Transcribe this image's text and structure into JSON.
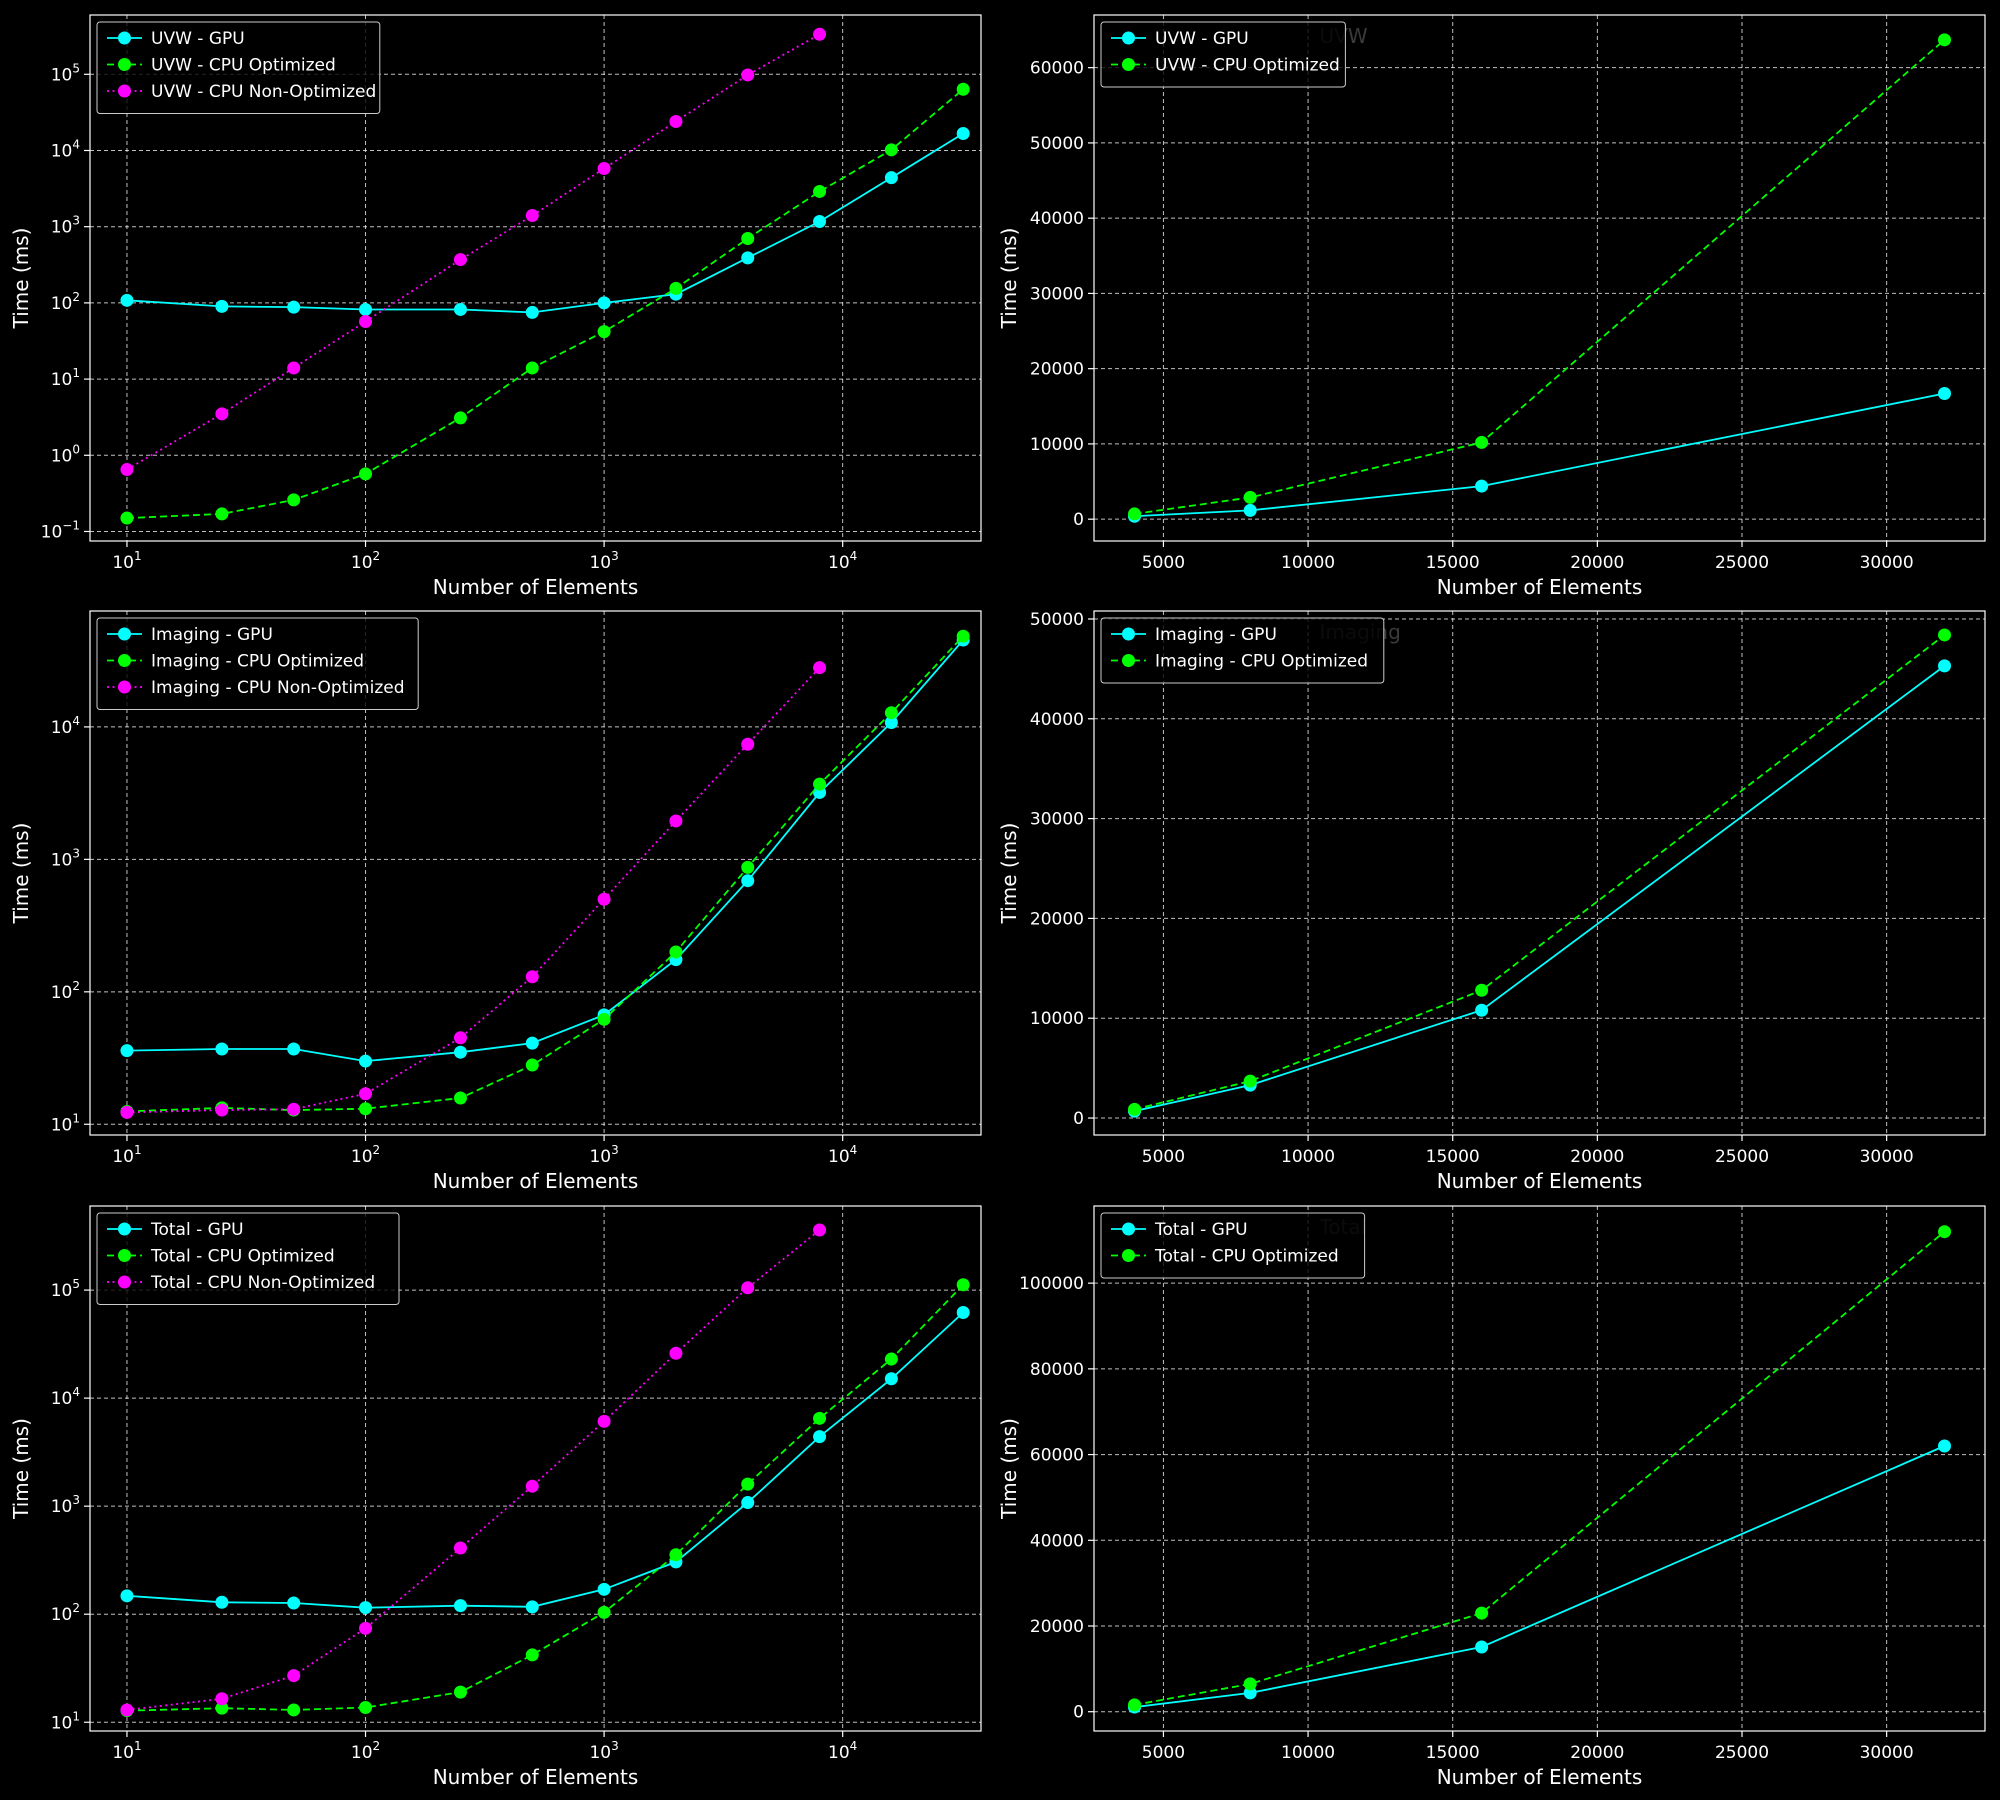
{
  "colors": {
    "background": "#000000",
    "foreground": "#ffffff",
    "grid": "#ffffff",
    "gpu": "#00ffff",
    "cpu_optimized": "#00ff00",
    "cpu_non_optimized": "#ff00ff",
    "faint_title": "#3a3a3a"
  },
  "chart_data": [
    {
      "type": "line",
      "panel": "top-left",
      "title": "",
      "xlabel": "Number of Elements",
      "ylabel": "Time (ms)",
      "xscale": "log",
      "yscale": "log",
      "xlim": [
        7,
        38000
      ],
      "ylim": [
        0.075,
        600000
      ],
      "grid": true,
      "legend_position": "upper-left",
      "x_ticks": [
        {
          "value": 10,
          "base": "10",
          "exp": "1"
        },
        {
          "value": 100,
          "base": "10",
          "exp": "2"
        },
        {
          "value": 1000,
          "base": "10",
          "exp": "3"
        },
        {
          "value": 10000,
          "base": "10",
          "exp": "4"
        }
      ],
      "y_ticks": [
        {
          "value": 0.1,
          "base": "10",
          "exp": "−1"
        },
        {
          "value": 1,
          "base": "10",
          "exp": "0"
        },
        {
          "value": 10,
          "base": "10",
          "exp": "1"
        },
        {
          "value": 100,
          "base": "10",
          "exp": "2"
        },
        {
          "value": 1000,
          "base": "10",
          "exp": "3"
        },
        {
          "value": 10000,
          "base": "10",
          "exp": "4"
        },
        {
          "value": 100000,
          "base": "10",
          "exp": "5"
        }
      ],
      "series": [
        {
          "name": "UVW - GPU",
          "color": "#00ffff",
          "style": "solid",
          "x": [
            10,
            25,
            50,
            100,
            250,
            500,
            1000,
            2000,
            4000,
            8000,
            16000,
            32000
          ],
          "y": [
            108,
            90,
            88,
            82,
            82,
            75,
            100,
            130,
            390,
            1170,
            4400,
            16700
          ]
        },
        {
          "name": "UVW - CPU Optimized",
          "color": "#00ff00",
          "style": "dashed",
          "x": [
            10,
            25,
            50,
            100,
            250,
            500,
            1000,
            2000,
            4000,
            8000,
            16000,
            32000
          ],
          "y": [
            0.15,
            0.17,
            0.26,
            0.57,
            3.1,
            14,
            42,
            155,
            700,
            2900,
            10200,
            63700
          ]
        },
        {
          "name": "UVW - CPU Non-Optimized",
          "color": "#ff00ff",
          "style": "dotted",
          "x": [
            10,
            25,
            50,
            100,
            250,
            500,
            1000,
            2000,
            4000,
            8000
          ],
          "y": [
            0.65,
            3.5,
            14,
            57,
            370,
            1400,
            5800,
            24000,
            98000,
            335000
          ]
        }
      ]
    },
    {
      "type": "line",
      "panel": "top-right",
      "title": "UVW",
      "xlabel": "Number of Elements",
      "ylabel": "Time (ms)",
      "xscale": "linear",
      "yscale": "linear",
      "xlim": [
        2600,
        33400
      ],
      "ylim": [
        -2900,
        67000
      ],
      "grid": true,
      "legend_position": "upper-left",
      "x_ticks": [
        {
          "value": 5000,
          "label": "5000"
        },
        {
          "value": 10000,
          "label": "10000"
        },
        {
          "value": 15000,
          "label": "15000"
        },
        {
          "value": 20000,
          "label": "20000"
        },
        {
          "value": 25000,
          "label": "25000"
        },
        {
          "value": 30000,
          "label": "30000"
        }
      ],
      "y_ticks": [
        {
          "value": 0,
          "label": "0"
        },
        {
          "value": 10000,
          "label": "10000"
        },
        {
          "value": 20000,
          "label": "20000"
        },
        {
          "value": 30000,
          "label": "30000"
        },
        {
          "value": 40000,
          "label": "40000"
        },
        {
          "value": 50000,
          "label": "50000"
        },
        {
          "value": 60000,
          "label": "60000"
        }
      ],
      "series": [
        {
          "name": "UVW - GPU",
          "color": "#00ffff",
          "style": "solid",
          "x": [
            4000,
            8000,
            16000,
            32000
          ],
          "y": [
            390,
            1170,
            4400,
            16700
          ]
        },
        {
          "name": "UVW - CPU Optimized",
          "color": "#00ff00",
          "style": "dashed",
          "x": [
            4000,
            8000,
            16000,
            32000
          ],
          "y": [
            700,
            2900,
            10200,
            63700
          ]
        }
      ]
    },
    {
      "type": "line",
      "panel": "middle-left",
      "title": "",
      "xlabel": "Number of Elements",
      "ylabel": "Time (ms)",
      "xscale": "log",
      "yscale": "log",
      "xlim": [
        7,
        38000
      ],
      "ylim": [
        8.3,
        75000
      ],
      "grid": true,
      "legend_position": "upper-left",
      "x_ticks": [
        {
          "value": 10,
          "base": "10",
          "exp": "1"
        },
        {
          "value": 100,
          "base": "10",
          "exp": "2"
        },
        {
          "value": 1000,
          "base": "10",
          "exp": "3"
        },
        {
          "value": 10000,
          "base": "10",
          "exp": "4"
        }
      ],
      "y_ticks": [
        {
          "value": 10,
          "base": "10",
          "exp": "1"
        },
        {
          "value": 100,
          "base": "10",
          "exp": "2"
        },
        {
          "value": 1000,
          "base": "10",
          "exp": "3"
        },
        {
          "value": 10000,
          "base": "10",
          "exp": "4"
        }
      ],
      "series": [
        {
          "name": "Imaging - GPU",
          "color": "#00ffff",
          "style": "solid",
          "x": [
            10,
            25,
            50,
            100,
            250,
            500,
            1000,
            2000,
            4000,
            8000,
            16000,
            32000
          ],
          "y": [
            36,
            37,
            37,
            30,
            35,
            41,
            67,
            175,
            690,
            3200,
            10800,
            45300
          ]
        },
        {
          "name": "Imaging - CPU Optimized",
          "color": "#00ff00",
          "style": "dashed",
          "x": [
            10,
            25,
            50,
            100,
            250,
            500,
            1000,
            2000,
            4000,
            8000,
            16000,
            32000
          ],
          "y": [
            12.5,
            13.3,
            12.8,
            13.1,
            15.8,
            28,
            62,
            200,
            870,
            3700,
            12800,
            48400
          ]
        },
        {
          "name": "Imaging - CPU Non-Optimized",
          "color": "#ff00ff",
          "style": "dotted",
          "x": [
            10,
            25,
            50,
            100,
            250,
            500,
            1000,
            2000,
            4000,
            8000
          ],
          "y": [
            12.3,
            12.8,
            13,
            17,
            45,
            130,
            500,
            1950,
            7400,
            28000
          ]
        }
      ]
    },
    {
      "type": "line",
      "panel": "middle-right",
      "title": "Imaging",
      "xlabel": "Number of Elements",
      "ylabel": "Time (ms)",
      "xscale": "linear",
      "yscale": "linear",
      "xlim": [
        2600,
        33400
      ],
      "ylim": [
        -1700,
        50800
      ],
      "grid": true,
      "legend_position": "upper-left",
      "x_ticks": [
        {
          "value": 5000,
          "label": "5000"
        },
        {
          "value": 10000,
          "label": "10000"
        },
        {
          "value": 15000,
          "label": "15000"
        },
        {
          "value": 20000,
          "label": "20000"
        },
        {
          "value": 25000,
          "label": "25000"
        },
        {
          "value": 30000,
          "label": "30000"
        }
      ],
      "y_ticks": [
        {
          "value": 0,
          "label": "0"
        },
        {
          "value": 10000,
          "label": "10000"
        },
        {
          "value": 20000,
          "label": "20000"
        },
        {
          "value": 30000,
          "label": "30000"
        },
        {
          "value": 40000,
          "label": "40000"
        },
        {
          "value": 50000,
          "label": "50000"
        }
      ],
      "series": [
        {
          "name": "Imaging - GPU",
          "color": "#00ffff",
          "style": "solid",
          "x": [
            4000,
            8000,
            16000,
            32000
          ],
          "y": [
            690,
            3300,
            10800,
            45300
          ]
        },
        {
          "name": "Imaging - CPU Optimized",
          "color": "#00ff00",
          "style": "dashed",
          "x": [
            4000,
            8000,
            16000,
            32000
          ],
          "y": [
            870,
            3700,
            12800,
            48400
          ]
        }
      ]
    },
    {
      "type": "line",
      "panel": "bottom-left",
      "title": "",
      "xlabel": "Number of Elements",
      "ylabel": "Time (ms)",
      "xscale": "log",
      "yscale": "log",
      "xlim": [
        7,
        38000
      ],
      "ylim": [
        8.3,
        600000
      ],
      "grid": true,
      "legend_position": "upper-left",
      "x_ticks": [
        {
          "value": 10,
          "base": "10",
          "exp": "1"
        },
        {
          "value": 100,
          "base": "10",
          "exp": "2"
        },
        {
          "value": 1000,
          "base": "10",
          "exp": "3"
        },
        {
          "value": 10000,
          "base": "10",
          "exp": "4"
        }
      ],
      "y_ticks": [
        {
          "value": 10,
          "base": "10",
          "exp": "1"
        },
        {
          "value": 100,
          "base": "10",
          "exp": "2"
        },
        {
          "value": 1000,
          "base": "10",
          "exp": "3"
        },
        {
          "value": 10000,
          "base": "10",
          "exp": "4"
        },
        {
          "value": 100000,
          "base": "10",
          "exp": "5"
        }
      ],
      "series": [
        {
          "name": "Total - GPU",
          "color": "#00ffff",
          "style": "solid",
          "x": [
            10,
            25,
            50,
            100,
            250,
            500,
            1000,
            2000,
            4000,
            8000,
            16000,
            32000
          ],
          "y": [
            148,
            129,
            127,
            115,
            120,
            117,
            170,
            305,
            1080,
            4400,
            15100,
            62000
          ]
        },
        {
          "name": "Total - CPU Optimized",
          "color": "#00ff00",
          "style": "dashed",
          "x": [
            10,
            25,
            50,
            100,
            250,
            500,
            1000,
            2000,
            4000,
            8000,
            16000,
            32000
          ],
          "y": [
            12.8,
            13.5,
            13,
            13.7,
            19,
            42,
            104,
            355,
            1600,
            6500,
            23000,
            112000
          ]
        },
        {
          "name": "Total - CPU Non-Optimized",
          "color": "#ff00ff",
          "style": "dotted",
          "x": [
            10,
            25,
            50,
            100,
            250,
            500,
            1000,
            2000,
            4000,
            8000
          ],
          "y": [
            13,
            16.5,
            27,
            74,
            410,
            1530,
            6100,
            26000,
            105000,
            360000
          ]
        }
      ]
    },
    {
      "type": "line",
      "panel": "bottom-right",
      "title": "Total",
      "xlabel": "Number of Elements",
      "ylabel": "Time (ms)",
      "xscale": "linear",
      "yscale": "linear",
      "xlim": [
        2600,
        33400
      ],
      "ylim": [
        -4500,
        118000
      ],
      "grid": true,
      "legend_position": "upper-left",
      "x_ticks": [
        {
          "value": 5000,
          "label": "5000"
        },
        {
          "value": 10000,
          "label": "10000"
        },
        {
          "value": 15000,
          "label": "15000"
        },
        {
          "value": 20000,
          "label": "20000"
        },
        {
          "value": 25000,
          "label": "25000"
        },
        {
          "value": 30000,
          "label": "30000"
        }
      ],
      "y_ticks": [
        {
          "value": 0,
          "label": "0"
        },
        {
          "value": 20000,
          "label": "20000"
        },
        {
          "value": 40000,
          "label": "40000"
        },
        {
          "value": 60000,
          "label": "60000"
        },
        {
          "value": 80000,
          "label": "80000"
        },
        {
          "value": 100000,
          "label": "100000"
        }
      ],
      "series": [
        {
          "name": "Total - GPU",
          "color": "#00ffff",
          "style": "solid",
          "x": [
            4000,
            8000,
            16000,
            32000
          ],
          "y": [
            1080,
            4400,
            15100,
            62000
          ]
        },
        {
          "name": "Total - CPU Optimized",
          "color": "#00ff00",
          "style": "dashed",
          "x": [
            4000,
            8000,
            16000,
            32000
          ],
          "y": [
            1600,
            6500,
            23000,
            112000
          ]
        }
      ]
    }
  ]
}
